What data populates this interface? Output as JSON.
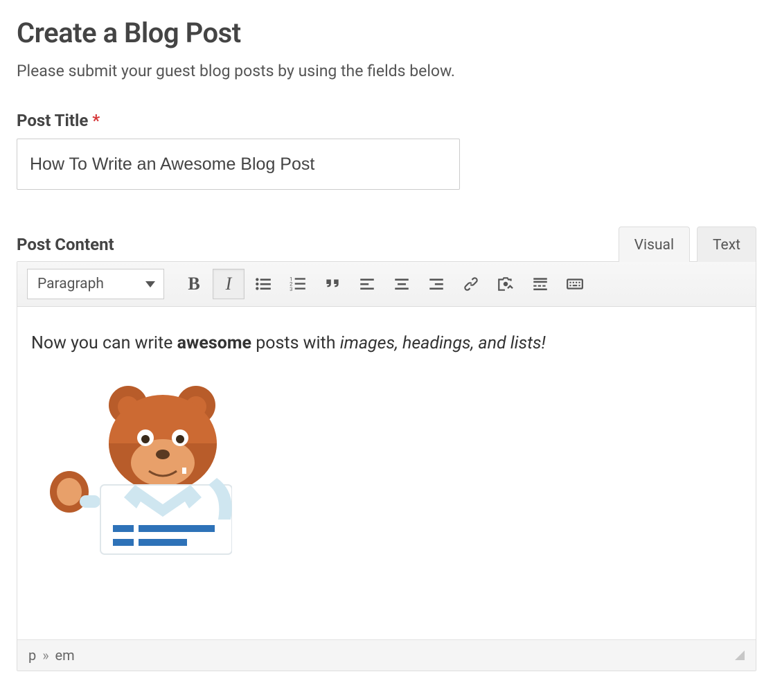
{
  "page": {
    "title": "Create a Blog Post",
    "description": "Please submit your guest blog posts by using the fields below."
  },
  "post_title": {
    "label": "Post Title",
    "required_marker": "*",
    "value": "How To Write an Awesome Blog Post"
  },
  "post_content": {
    "label": "Post Content",
    "tabs": {
      "visual": "Visual",
      "text": "Text",
      "active": "visual"
    },
    "format_dropdown": {
      "selected": "Paragraph"
    },
    "toolbar_buttons": [
      {
        "name": "bold",
        "icon": "bold-icon",
        "active": false
      },
      {
        "name": "italic",
        "icon": "italic-icon",
        "active": true
      },
      {
        "name": "bullet-list",
        "icon": "bullet-list-icon",
        "active": false
      },
      {
        "name": "numbered-list",
        "icon": "numbered-list-icon",
        "active": false
      },
      {
        "name": "blockquote",
        "icon": "quote-icon",
        "active": false
      },
      {
        "name": "align-left",
        "icon": "align-left-icon",
        "active": false
      },
      {
        "name": "align-center",
        "icon": "align-center-icon",
        "active": false
      },
      {
        "name": "align-right",
        "icon": "align-right-icon",
        "active": false
      },
      {
        "name": "link",
        "icon": "link-icon",
        "active": false
      },
      {
        "name": "insert-media",
        "icon": "media-icon",
        "active": false
      },
      {
        "name": "read-more",
        "icon": "read-more-icon",
        "active": false
      },
      {
        "name": "toolbar-toggle",
        "icon": "keyboard-icon",
        "active": false
      }
    ],
    "body": {
      "line1_prefix": "Now you can write ",
      "line1_bold": "awesome",
      "line1_mid": " posts with ",
      "line1_italic": "images, headings, and lists!"
    },
    "image": {
      "name": "bear-mascot-image"
    },
    "status_path": {
      "seg1": "p",
      "sep": "»",
      "seg2": "em"
    }
  }
}
